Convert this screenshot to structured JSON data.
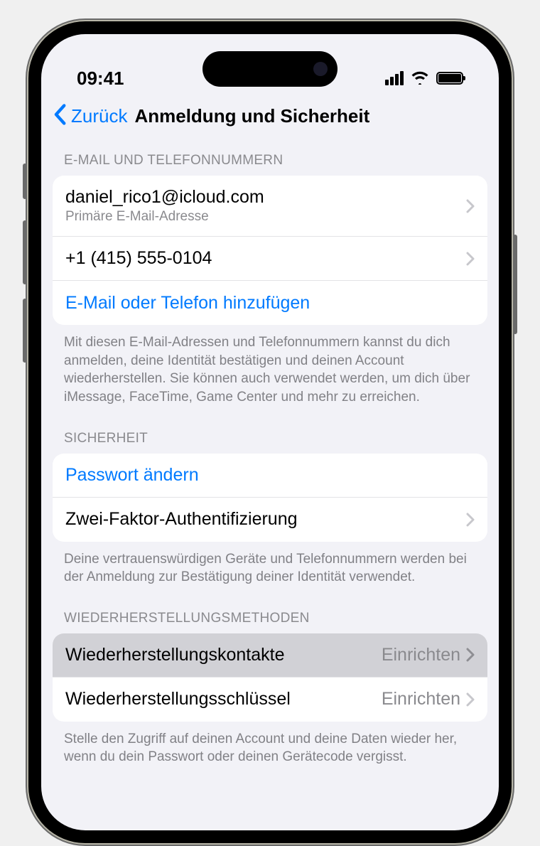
{
  "status": {
    "time": "09:41"
  },
  "nav": {
    "back": "Zurück",
    "title": "Anmeldung und Sicherheit"
  },
  "sections": {
    "contacts": {
      "header": "E-MAIL UND TELEFONNUMMERN",
      "email": {
        "value": "daniel_rico1@icloud.com",
        "sub": "Primäre E-Mail-Adresse"
      },
      "phone": {
        "value": "+1 (415) 555-0104"
      },
      "add": {
        "label": "E-Mail oder Telefon hinzufügen"
      },
      "footer": "Mit diesen E-Mail-Adressen und Telefonnummern kannst du dich anmelden, deine Identität bestätigen und deinen Account wiederherstellen. Sie können auch verwendet werden, um dich über iMessage, FaceTime, Game Center und mehr zu erreichen."
    },
    "security": {
      "header": "SICHERHEIT",
      "change_password": "Passwort ändern",
      "two_factor": "Zwei-Faktor-Authentifizierung",
      "footer": "Deine vertrauenswürdigen Geräte und Telefon­nummern werden bei der Anmeldung zur Bestätigung deiner Identität verwendet."
    },
    "recovery": {
      "header": "WIEDERHERSTELLUNGSMETHODEN",
      "contacts": {
        "label": "Wiederherstellungskontakte",
        "detail": "Einrichten"
      },
      "key": {
        "label": "Wiederherstellungsschlüssel",
        "detail": "Einrichten"
      },
      "footer": "Stelle den Zugriff auf deinen Account und deine Daten wieder her, wenn du dein Passwort oder deinen Gerätecode vergisst."
    }
  }
}
